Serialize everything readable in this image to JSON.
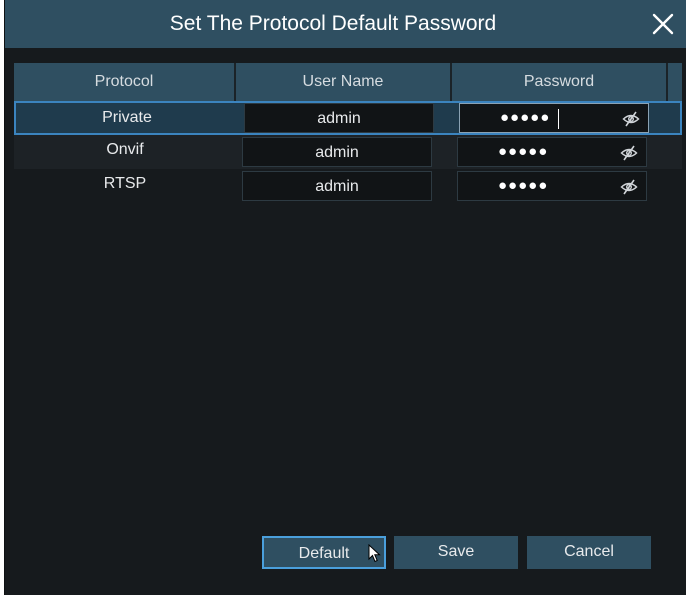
{
  "dialog": {
    "title": "Set The Protocol Default Password",
    "close_icon": "close-icon"
  },
  "table": {
    "headers": [
      "Protocol",
      "User Name",
      "Password"
    ],
    "rows": [
      {
        "protocol": "Private",
        "user_name": "admin",
        "password_masked": "●●●●●",
        "selected": true
      },
      {
        "protocol": "Onvif",
        "user_name": "admin",
        "password_masked": "●●●●●",
        "selected": false
      },
      {
        "protocol": "RTSP",
        "user_name": "admin",
        "password_masked": "●●●●●",
        "selected": false
      }
    ],
    "password_toggle_icon": "eye-slash-icon"
  },
  "buttons": {
    "default_label": "Default",
    "save_label": "Save",
    "cancel_label": "Cancel"
  },
  "colors": {
    "titlebar": "#2f4f61",
    "background": "#161a1d",
    "selection_border": "#3b84bf",
    "focus_border": "#4a9fdc"
  }
}
